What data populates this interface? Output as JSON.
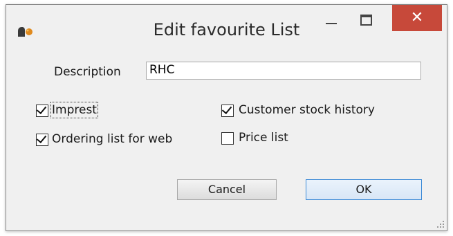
{
  "window": {
    "title": "Edit favourite List"
  },
  "form": {
    "description_label": "Description",
    "description_value": "RHC",
    "checkboxes": [
      {
        "label": "Imprest",
        "checked": true
      },
      {
        "label": "Ordering list for web",
        "checked": true
      },
      {
        "label": "Customer stock history",
        "checked": true
      },
      {
        "label": "Price list",
        "checked": false
      }
    ]
  },
  "buttons": {
    "cancel": "Cancel",
    "ok": "OK"
  },
  "colors": {
    "close_button": "#c7493a",
    "ok_border": "#3c8ad6"
  },
  "icons": [
    "app-icon",
    "minimize-icon",
    "maximize-icon",
    "close-icon",
    "resize-grip-icon"
  ]
}
